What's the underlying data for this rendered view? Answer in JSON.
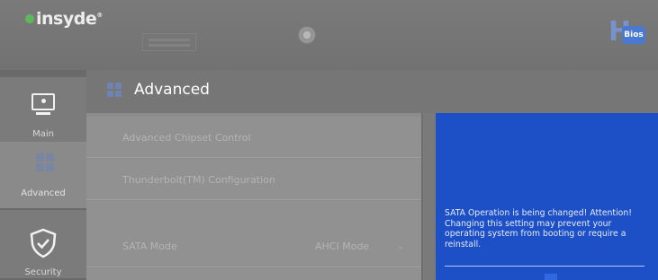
{
  "header": {
    "logo_text": "insyde",
    "trademark": "®",
    "bios_badge": "Bios",
    "bios_letter": "H"
  },
  "sidebar": {
    "items": [
      {
        "label": "Main",
        "icon": "monitor-icon",
        "selected": false
      },
      {
        "label": "Advanced",
        "icon": "advanced-icon",
        "selected": true
      },
      {
        "label": "Security",
        "icon": "shield-icon",
        "selected": false
      }
    ]
  },
  "page": {
    "title": "Advanced"
  },
  "settings": {
    "rows": [
      {
        "label": "Advanced Chipset Control",
        "value": ""
      },
      {
        "label": "Thunderbolt(TM) Configuration",
        "value": ""
      },
      {
        "label": "",
        "value": ""
      },
      {
        "label": "SATA Mode",
        "value": "AHCI Mode"
      }
    ]
  },
  "help": {
    "text": "SATA Operation is being changed! Attention! Changing this setting may prevent your operating system from booting or require a reinstall."
  },
  "colors": {
    "help_panel": "#1d4fc6",
    "accent_green": "#5db85c"
  }
}
